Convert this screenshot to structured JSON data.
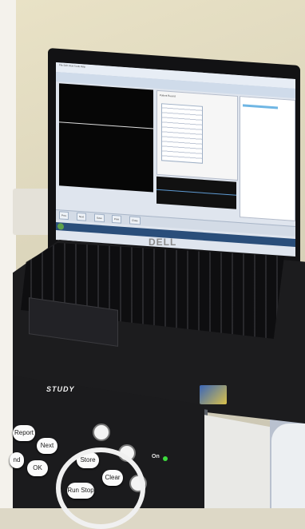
{
  "laptop": {
    "brand": "DELL"
  },
  "console": {
    "study_label": "STUDY",
    "keys": [
      "Report",
      "Next",
      "Store",
      "Clear",
      "OK",
      "Run Stop",
      "nd"
    ],
    "status_label": "On"
  },
  "screen": {
    "menu": "File  Edit  View  Tools  Help",
    "form_title": "Patient Record",
    "status_tabs": [
      "Prev",
      "Next",
      "Save",
      "Print",
      "Close"
    ]
  },
  "colors": {
    "led": "#3ddc3d",
    "screen_accent": "#6fb6e4"
  },
  "icons": [
    "windows-start-icon",
    "intel-sticker-icon",
    "power-led-icon"
  ]
}
